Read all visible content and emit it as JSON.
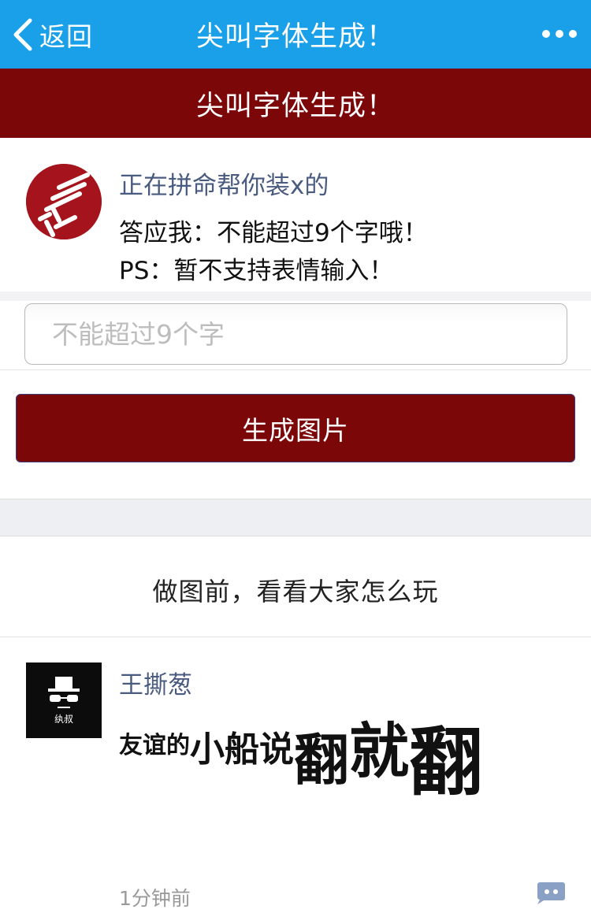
{
  "navbar": {
    "back_label": "返回",
    "title": "尖叫字体生成！",
    "background": "#1aa0e8"
  },
  "banner": {
    "title": "尖叫字体生成！",
    "background": "#7b0709"
  },
  "info": {
    "name": "正在拼命帮你装x的",
    "line1": "答应我：不能超过9个字哦！",
    "line2": "PS：暂不支持表情输入！"
  },
  "input": {
    "placeholder": "不能超过9个字",
    "value": ""
  },
  "generate_button": {
    "label": "生成图片"
  },
  "section_heading": "做图前，看看大家怎么玩",
  "post": {
    "author": "王撕葱",
    "image_text": {
      "a": "友谊的",
      "b": "小船",
      "c": "说",
      "d": "翻",
      "e": "就",
      "f": "翻"
    },
    "avatar_caption": "纨叔",
    "time": "1分钟前"
  },
  "icons": {
    "back": "chevron-left-icon",
    "more": "more-dots-icon",
    "comment": "comment-icon"
  }
}
